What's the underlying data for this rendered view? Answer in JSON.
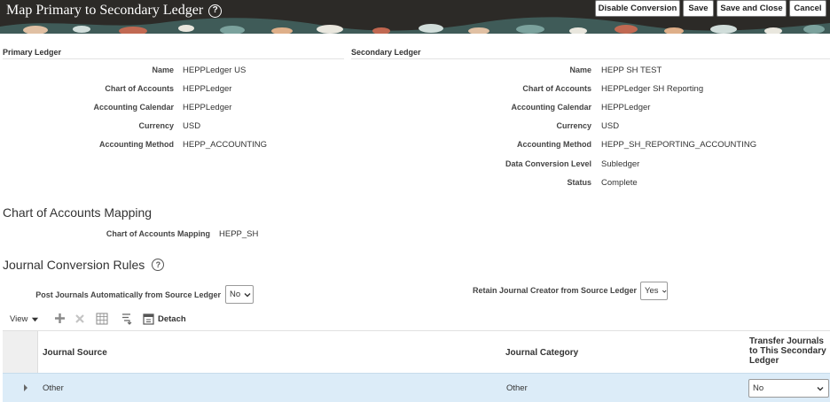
{
  "header": {
    "title": "Map Primary to Secondary Ledger",
    "buttons": {
      "disable_conversion": "Disable Conversion",
      "save": "Save",
      "save_and_close": "Save and Close",
      "cancel": "Cancel"
    }
  },
  "primary_ledger": {
    "heading": "Primary Ledger",
    "fields": [
      {
        "label": "Name",
        "value": "HEPPLedger US"
      },
      {
        "label": "Chart of Accounts",
        "value": "HEPPLedger"
      },
      {
        "label": "Accounting Calendar",
        "value": "HEPPLedger"
      },
      {
        "label": "Currency",
        "value": "USD"
      },
      {
        "label": "Accounting Method",
        "value": "HEPP_ACCOUNTING"
      }
    ]
  },
  "secondary_ledger": {
    "heading": "Secondary Ledger",
    "fields": [
      {
        "label": "Name",
        "value": "HEPP SH TEST"
      },
      {
        "label": "Chart of Accounts",
        "value": "HEPPLedger SH Reporting"
      },
      {
        "label": "Accounting Calendar",
        "value": "HEPPLedger"
      },
      {
        "label": "Currency",
        "value": "USD"
      },
      {
        "label": "Accounting Method",
        "value": "HEPP_SH_REPORTING_ACCOUNTING"
      },
      {
        "label": "Data Conversion Level",
        "value": "Subledger"
      },
      {
        "label": "Status",
        "value": "Complete"
      }
    ]
  },
  "coa_mapping": {
    "heading": "Chart of Accounts Mapping",
    "label": "Chart of Accounts Mapping",
    "value": "HEPP_SH"
  },
  "journal_rules": {
    "heading": "Journal Conversion Rules",
    "post_auto_label": "Post Journals Automatically from Source Ledger",
    "post_auto_value": "No",
    "retain_creator_label": "Retain Journal Creator from Source Ledger",
    "retain_creator_value": "Yes"
  },
  "toolbar": {
    "view_label": "View",
    "detach_label": "Detach"
  },
  "table": {
    "columns": {
      "journal_source": "Journal Source",
      "journal_category": "Journal Category",
      "transfer_1": "Transfer Journals",
      "transfer_2": "to This Secondary",
      "transfer_3": "Ledger"
    },
    "rows": [
      {
        "journal_source": "Other",
        "journal_category": "Other",
        "transfer": "No"
      }
    ]
  },
  "colors": {
    "header_bg": "#2c2a27",
    "selected_row": "#dcecf8",
    "row_header_bg": "#efefef"
  },
  "icons": [
    "help-icon",
    "add-icon",
    "delete-icon",
    "freeze-icon",
    "wrap-icon",
    "detach-icon",
    "expand-icon",
    "chevron-down-icon"
  ]
}
